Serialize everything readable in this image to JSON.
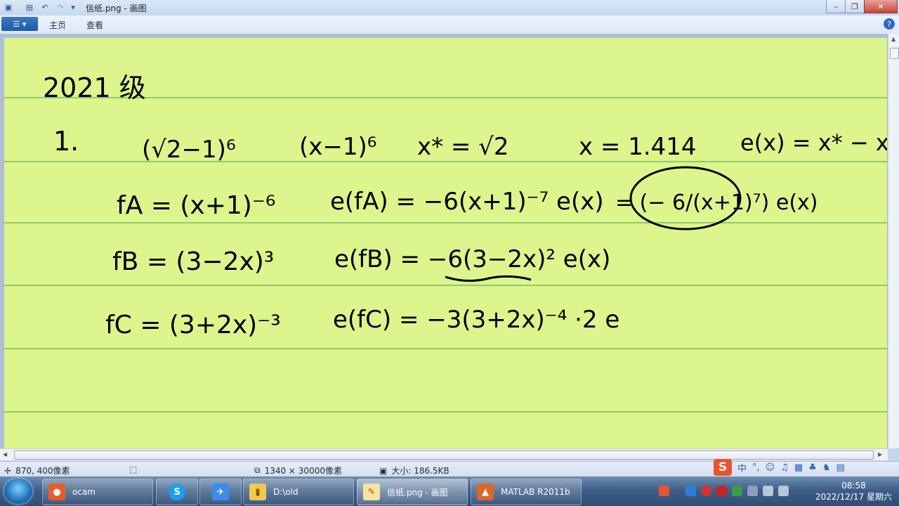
{
  "window": {
    "title": "信纸.png - 画图"
  },
  "ribbon": {
    "tabs": [
      "主页",
      "查看"
    ],
    "help": "?"
  },
  "status": {
    "cursor": "870, 400像素",
    "size": "1340 × 30000像素",
    "filesize": "大小: 186.5KB"
  },
  "taskbar": {
    "items": [
      {
        "label": "ocam",
        "icon": "ocam-icon"
      },
      {
        "label": "",
        "icon": "sogou-app-icon"
      },
      {
        "label": "",
        "icon": "feishu-icon"
      },
      {
        "label": "D:\\old",
        "icon": "folder-icon"
      },
      {
        "label": "信纸.png - 画图",
        "icon": "paint-icon"
      },
      {
        "label": "MATLAB  R2011b",
        "icon": "matlab-icon"
      }
    ],
    "clock_time": "08:58",
    "clock_date": "2022/12/17 星期六"
  },
  "ime": {
    "mode": "中",
    "punct": "°,"
  },
  "handwriting": {
    "header": "2021 级",
    "row1": {
      "num": "1.",
      "expr1": "(√2−1)⁶",
      "expr2": "(x−1)⁶",
      "xstar": "x* = √2",
      "x": "x = 1.414",
      "ex": "e(x) = x* − x"
    },
    "fa": {
      "lhs": "fA = (x+1)⁻⁶",
      "err": "e(fA) = −6(x+1)⁻⁷ e(x)",
      "circled": "= (− 6/(x+1)⁷) e(x)"
    },
    "fb": {
      "lhs": "fB = (3−2x)³",
      "err": "e(fB) = −6(3−2x)² e(x)"
    },
    "fc": {
      "lhs": "fC = (3+2x)⁻³",
      "err": "e(fC) = −3(3+2x)⁻⁴ ·2 e"
    }
  }
}
